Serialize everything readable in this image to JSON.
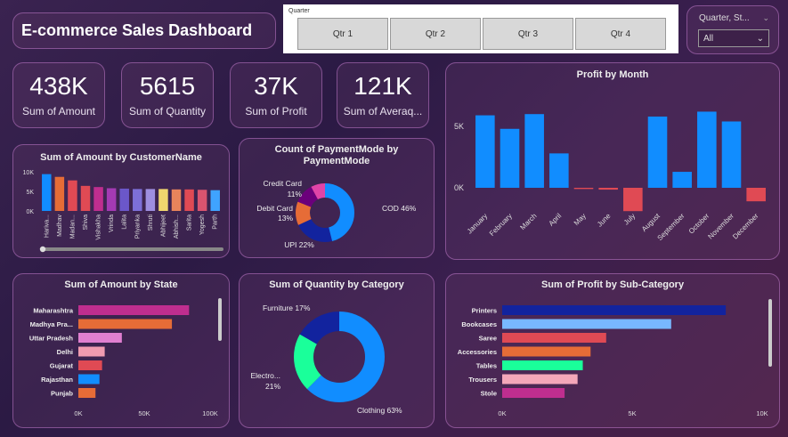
{
  "header": {
    "title": "E-commerce Sales Dashboard"
  },
  "quarter_slicer": {
    "label": "Quarter",
    "options": [
      "Qtr 1",
      "Qtr 2",
      "Qtr 3",
      "Qtr 4"
    ]
  },
  "dropdown": {
    "title": "Quarter, St...",
    "value": "All"
  },
  "kpis": [
    {
      "value": "438K",
      "label": "Sum of Amount"
    },
    {
      "value": "5615",
      "label": "Sum of Quantity"
    },
    {
      "value": "37K",
      "label": "Sum of Profit"
    },
    {
      "value": "121K",
      "label": "Sum of Averaq..."
    }
  ],
  "colors": {
    "accent_blue": "#118dff",
    "dark_blue": "#12239e",
    "red": "#e04a54",
    "magenta": "#bf2e8f",
    "teal": "#1aff9a"
  },
  "chart_data": [
    {
      "id": "customer",
      "type": "bar",
      "title": "Sum of Amount by CustomerName",
      "categories": [
        "Harivansh",
        "Madhav",
        "Madan",
        "Shiva",
        "Vishakha",
        "Vrinda",
        "Lalita",
        "Priyanka",
        "Shruti",
        "Abhijeet",
        "Abhishek",
        "Sarita",
        "Yogesh",
        "Parth"
      ],
      "display_labels": [
        "Hariva...",
        "Madhav",
        "Madan...",
        "Shiva",
        "Vishakha",
        "Vrinda",
        "Lalita",
        "Priyanka",
        "Shruti",
        "Abhijeet",
        "Abhish...",
        "Sarita",
        "Yogesh",
        "Parth"
      ],
      "values": [
        9400,
        8700,
        7800,
        6400,
        6100,
        5800,
        5700,
        5600,
        5600,
        5600,
        5500,
        5500,
        5400,
        5300
      ],
      "colors": [
        "#118dff",
        "#e66c37",
        "#e04a54",
        "#e04a54",
        "#bf2e8f",
        "#a43ab4",
        "#6b57c9",
        "#7d6fd8",
        "#9e8ee0",
        "#f0d66e",
        "#e8845b",
        "#e04a54",
        "#d9546f",
        "#3fa3ff"
      ],
      "yticks": [
        "10K",
        "5K",
        "0K"
      ],
      "ylim": [
        0,
        10000
      ]
    },
    {
      "id": "payment",
      "type": "pie",
      "title": "Count of PaymentMode by PaymentMode",
      "slices": [
        {
          "label": "COD",
          "value": 46,
          "color": "#118dff"
        },
        {
          "label": "UPI",
          "value": 22,
          "color": "#12239e"
        },
        {
          "label": "Debit Card",
          "value": 13,
          "color": "#e66c37"
        },
        {
          "label": "Credit Card",
          "value": 11,
          "color": "#6b007b"
        },
        {
          "label": "",
          "value": 8,
          "color": "#e044a7"
        }
      ],
      "labels": [
        "COD 46%",
        "UPI 22%",
        "Debit Card",
        "13%",
        "Credit Card",
        "11%"
      ]
    },
    {
      "id": "month",
      "type": "bar",
      "title": "Profit by Month",
      "categories": [
        "January",
        "February",
        "March",
        "April",
        "May",
        "June",
        "July",
        "August",
        "September",
        "October",
        "November",
        "December"
      ],
      "values": [
        5900,
        4800,
        6000,
        2800,
        -100,
        -150,
        -1900,
        5800,
        1300,
        6200,
        5400,
        -1100
      ],
      "yticks": [
        "5K",
        "0K"
      ],
      "ylim": [
        -2500,
        6800
      ]
    },
    {
      "id": "state",
      "type": "bar",
      "title": "Sum of Amount by State",
      "categories": [
        "Maharashtra",
        "Madhya Pra...",
        "Uttar Pradesh",
        "Delhi",
        "Gujarat",
        "Rajasthan",
        "Punjab"
      ],
      "values": [
        84000,
        71000,
        33000,
        20000,
        18000,
        16000,
        13000
      ],
      "colors": [
        "#bf2e8f",
        "#e66c37",
        "#e07fd0",
        "#f09bb0",
        "#e04a54",
        "#118dff",
        "#e66c37"
      ],
      "xticks": [
        "0K",
        "50K",
        "100K"
      ],
      "xlim": [
        0,
        100000
      ]
    },
    {
      "id": "category",
      "type": "pie",
      "title": "Sum of Quantity by Category",
      "slices": [
        {
          "label": "Clothing",
          "value": 63,
          "color": "#118dff"
        },
        {
          "label": "Electronics",
          "value": 21,
          "color": "#1aff9a"
        },
        {
          "label": "Furniture",
          "value": 17,
          "color": "#12239e"
        }
      ],
      "labels": [
        "Furniture 17%",
        "Electro...",
        "21%",
        "Clothing 63%"
      ]
    },
    {
      "id": "subcat",
      "type": "bar",
      "title": "Sum of Profit by Sub-Category",
      "categories": [
        "Printers",
        "Bookcases",
        "Saree",
        "Accessories",
        "Tables",
        "Trousers",
        "Stole"
      ],
      "values": [
        8600,
        6500,
        4000,
        3400,
        3100,
        2900,
        2400
      ],
      "colors": [
        "#12239e",
        "#78b8ff",
        "#e04a54",
        "#e66c37",
        "#1aff9a",
        "#f4a7b9",
        "#bf2e8f"
      ],
      "xticks": [
        "0K",
        "5K",
        "10K"
      ],
      "xlim": [
        0,
        10000
      ]
    }
  ]
}
